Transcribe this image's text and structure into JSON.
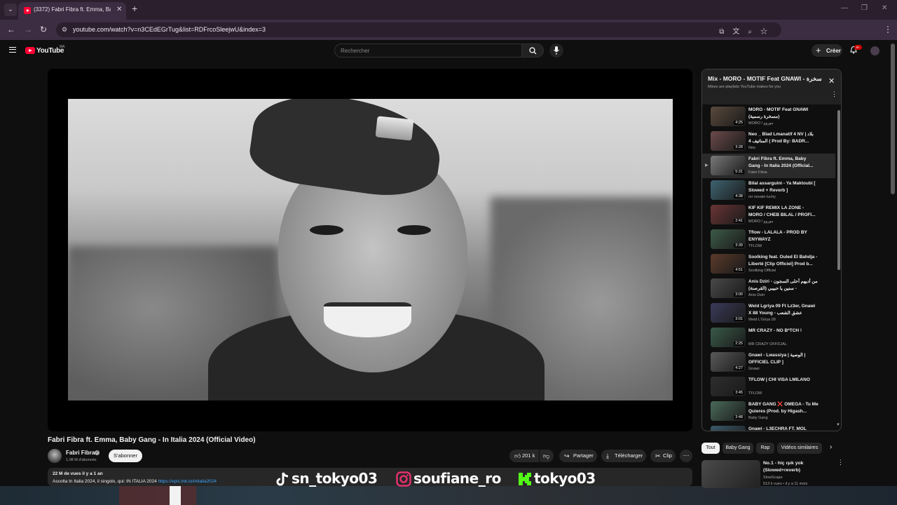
{
  "browser": {
    "tab_title": "(3372) Fabri Fibra ft. Emma, Bab",
    "url": "youtube.com/watch?v=n3CEdEGrTug&list=RDFrcoSleejwU&index=3"
  },
  "masthead": {
    "logo": "YouTube",
    "country": "MA",
    "search_placeholder": "Rechercher",
    "create_label": "Créer",
    "notif_count": "9+"
  },
  "video": {
    "title": "Fabri Fibra ft. Emma, Baby Gang - In Italia 2024 (Official Video)",
    "channel": "Fabri Fibra",
    "subscribers": "1,08 M d'abonnés",
    "subscribe_label": "S'abonner",
    "likes": "201 k",
    "share_label": "Partager",
    "download_label": "Télécharger",
    "clip_label": "Clip",
    "views_meta": "22 M de vues  il y a 1 an",
    "description": "Ascolta In Italia 2024, il singolo, qui: IN ITALIA 2024 ",
    "description_link": "https://epic.lnk.to/initalia2024"
  },
  "overlay": {
    "tiktok": "sn_tokyo03",
    "instagram": "soufiane_ro",
    "kick": "tokyo03"
  },
  "playlist": {
    "title": "Mix - MORO - MOTIF Feat GNAWI - مسخرة",
    "subtitle": "Mixes are playlists YouTube makes for you",
    "items": [
      {
        "title": "MORO - MOTIF Feat GNAWI (مسخرة رسمية)",
        "channel": "MORO / موروو",
        "duration": "4:25",
        "color": "#5a4a3c"
      },
      {
        "title": "Neo _ Blad Lmanatif 4 NV | بلاد المناتيف 4 ( Prod By: BADR...",
        "channel": "Neo",
        "duration": "3:28",
        "color": "#6b4a4a"
      },
      {
        "title": "Fabri Fibra ft. Emma, Baby Gang - In Italia 2024 (Official...",
        "channel": "Fabri Fibra",
        "duration": "5:31",
        "color": "#7a7a7a",
        "active": true
      },
      {
        "title": "Bilal assarguini - Ya Maktoubi [ Slowed + Reverb ]",
        "channel": "mr novato luchy",
        "duration": "4:38",
        "color": "#3e6470"
      },
      {
        "title": "KIF KIF REMIX LA ZONE - MORO / CHEB BILAL / PROFI...",
        "channel": "MORO / موروو",
        "duration": "2:41",
        "color": "#6a3434"
      },
      {
        "title": "Tflow - LALALA - PROD BY ENYWAYZ",
        "channel": "TFLOW",
        "duration": "3:39",
        "color": "#3d5a48"
      },
      {
        "title": "Soolking feat. Ouled El Bahdja - Liberté [Clip Officiel] Prod b...",
        "channel": "Soolking Officiel",
        "duration": "4:51",
        "color": "#5a3a2a"
      },
      {
        "title": "Anis Dziri - من أديهم أحلى السجون - سنين يا حبيبي (القرصنة)",
        "channel": "Anis Dziri",
        "duration": "3:00",
        "color": "#4a4a4a"
      },
      {
        "title": "Weld Lgriya 09 Ft Lz3er, Gnawi X 88 Young - عشق الشعب",
        "channel": "Weld L'Griya 09",
        "duration": "3:01",
        "color": "#3a3a5a"
      },
      {
        "title": "MR CRAZY - NO B*TCH !",
        "channel": "MR CRAZY OFFICIAL",
        "duration": "2:25",
        "color": "#3a5a4a"
      },
      {
        "title": "Gnawi - Lwassiya | الوصية | OFFICIEL CLIP ]",
        "channel": "Gnawi",
        "duration": "4:27",
        "color": "#5a5a5a"
      },
      {
        "title": "TFLOW | CHI VISA LMILANO",
        "channel": "TFLOW",
        "duration": "3:45",
        "color": "#2e2e2e"
      },
      {
        "title": "BABY GANG ❌ OMEGA - Tu Me Quieres (Prod. by Higash...",
        "channel": "Baby Gang",
        "duration": "3:48",
        "color": "#4a6a5a"
      },
      {
        "title": "Gnawi - L3ECHRA FT. MOL",
        "channel": "",
        "duration": "",
        "color": "#3a5a6a"
      }
    ]
  },
  "chips": [
    "Tout",
    "Baby Gang",
    "Rap",
    "Vidéos similaires"
  ],
  "related": {
    "title": "No.1 - hiç ışık yok (Slowed+reverb)",
    "channel": "SlowScape",
    "meta": "513 k vues • il y a 11 mois"
  },
  "colors": {
    "accent": "#ff0033",
    "link": "#3ea6ff",
    "chrome": "#3d2d42"
  }
}
